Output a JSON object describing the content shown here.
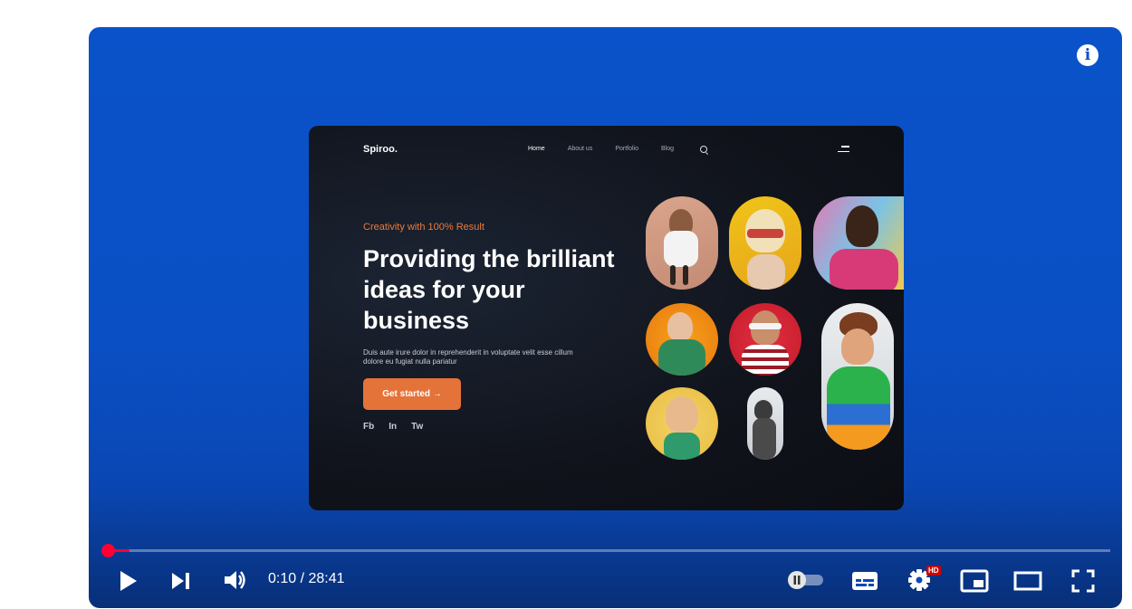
{
  "frame": {
    "brand": "Spiroo.",
    "nav": [
      "Home",
      "About us",
      "Portfolio",
      "Blog"
    ],
    "tagline": "Creativity  with 100% Result",
    "headline": "Providing the brilliant ideas for your business",
    "description": "Duis aute irure dolor in reprehenderit in voluptate velit esse cillum dolore eu fugiat nulla pariatur",
    "cta_label": "Get started →",
    "social": [
      "Fb",
      "In",
      "Tw"
    ]
  },
  "controls": {
    "time": "0:10 / 28:41",
    "progress_fraction": 0.0058,
    "hd_badge": "HD",
    "colors": {
      "accent": "#ff0033",
      "background": "#0a4fc4",
      "cta": "#e4733a"
    },
    "icons": [
      "play-icon",
      "next-icon",
      "volume-icon",
      "autoplay-toggle",
      "subtitles-icon",
      "settings-icon",
      "miniplayer-icon",
      "theater-icon",
      "fullscreen-icon",
      "info-icon"
    ]
  }
}
